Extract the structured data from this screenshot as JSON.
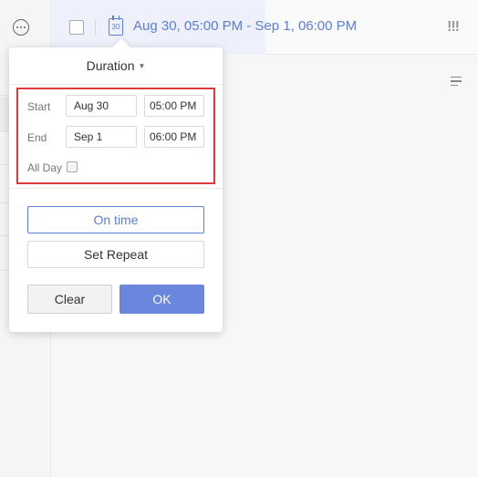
{
  "header": {
    "calendar_icon_day": "30",
    "date_range": "Aug 30, 05:00 PM - Sep 1, 06:00 PM",
    "priority_icon": "!!!"
  },
  "popover": {
    "tab_title": "Duration",
    "start": {
      "label": "Start",
      "date": "Aug 30",
      "time": "05:00 PM"
    },
    "end": {
      "label": "End",
      "date": "Sep 1",
      "time": "06:00 PM"
    },
    "all_day_label": "All Day",
    "on_time_label": "On time",
    "set_repeat_label": "Set Repeat",
    "clear_label": "Clear",
    "ok_label": "OK"
  },
  "colors": {
    "accent": "#5a7fd6",
    "ok_button": "#6a86dd",
    "highlight_border": "#e03a3a"
  }
}
